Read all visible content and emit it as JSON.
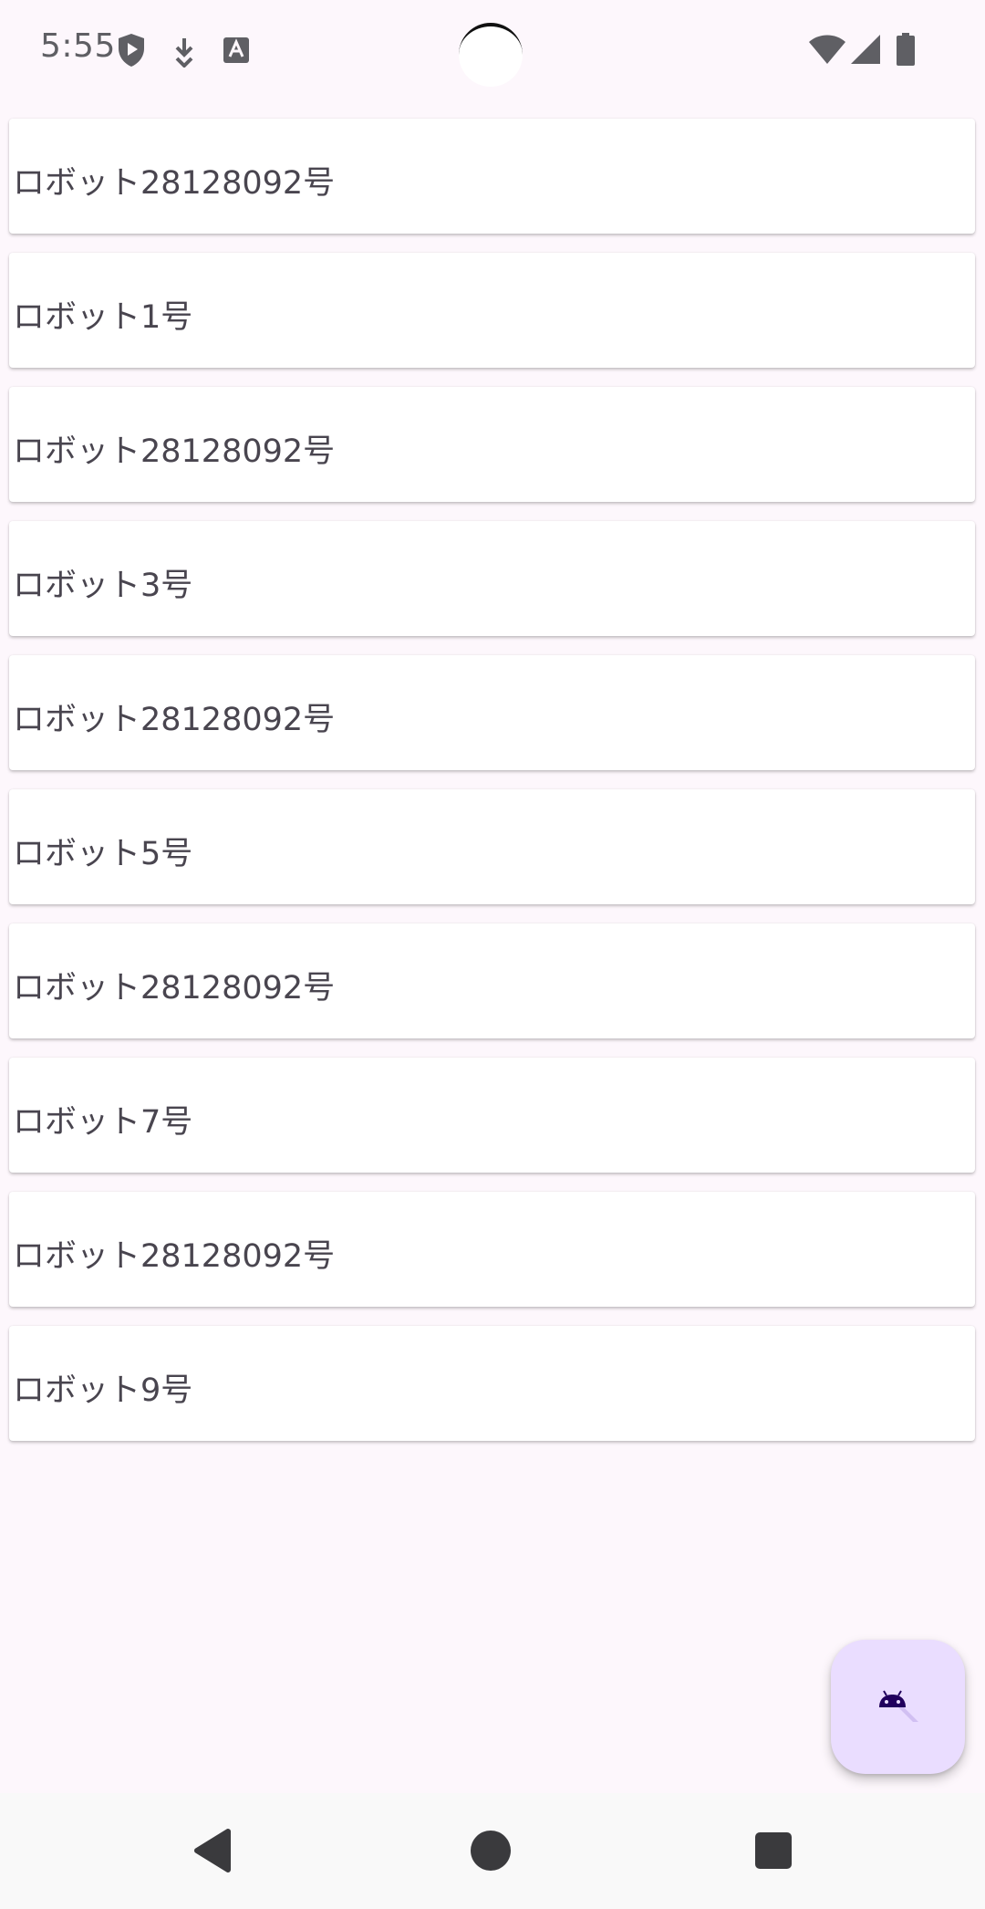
{
  "status_bar": {
    "time": "5:55",
    "icons_left": [
      "shield-play-icon",
      "download-icon",
      "font-icon"
    ],
    "icons_right": [
      "wifi-icon",
      "signal-icon",
      "battery-icon"
    ]
  },
  "robots": [
    {
      "label": "ロボット28128092号"
    },
    {
      "label": "ロボット1号"
    },
    {
      "label": "ロボット28128092号"
    },
    {
      "label": "ロボット3号"
    },
    {
      "label": "ロボット28128092号"
    },
    {
      "label": "ロボット5号"
    },
    {
      "label": "ロボット28128092号"
    },
    {
      "label": "ロボット7号"
    },
    {
      "label": "ロボット28128092号"
    },
    {
      "label": "ロボット9号"
    }
  ],
  "fab": {
    "icon": "android-icon"
  },
  "nav": {
    "buttons": [
      "back-icon",
      "home-icon",
      "recents-icon"
    ]
  },
  "colors": {
    "background": "#fdf7fc",
    "card": "#ffffff",
    "text": "#49454f",
    "fab": "#eaddff",
    "fab_icon": "#21005d"
  }
}
